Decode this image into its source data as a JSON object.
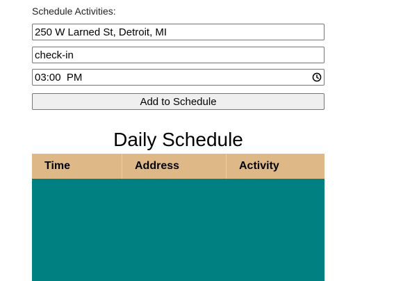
{
  "form": {
    "label": "Schedule Activities:",
    "address_value": "250 W Larned St, Detroit, MI",
    "activity_value": "check-in",
    "time_value": "03:00  PM",
    "add_button_label": "Add to Schedule"
  },
  "schedule": {
    "title": "Daily Schedule",
    "columns": [
      "Time",
      "Address",
      "Activity"
    ]
  },
  "colors": {
    "header_bg": "#deb887",
    "body_bg": "#008080"
  }
}
